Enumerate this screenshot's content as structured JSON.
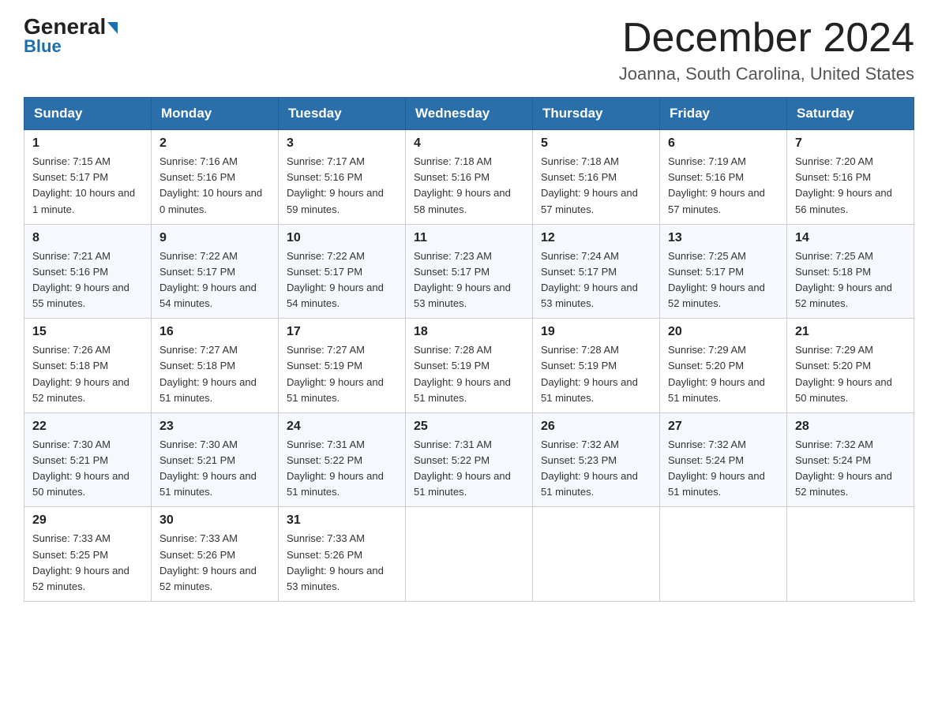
{
  "header": {
    "logo": {
      "line1": "General",
      "line2": "Blue"
    },
    "title": "December 2024",
    "subtitle": "Joanna, South Carolina, United States"
  },
  "weekdays": [
    "Sunday",
    "Monday",
    "Tuesday",
    "Wednesday",
    "Thursday",
    "Friday",
    "Saturday"
  ],
  "weeks": [
    [
      {
        "day": "1",
        "sunrise": "7:15 AM",
        "sunset": "5:17 PM",
        "daylight": "10 hours and 1 minute."
      },
      {
        "day": "2",
        "sunrise": "7:16 AM",
        "sunset": "5:16 PM",
        "daylight": "10 hours and 0 minutes."
      },
      {
        "day": "3",
        "sunrise": "7:17 AM",
        "sunset": "5:16 PM",
        "daylight": "9 hours and 59 minutes."
      },
      {
        "day": "4",
        "sunrise": "7:18 AM",
        "sunset": "5:16 PM",
        "daylight": "9 hours and 58 minutes."
      },
      {
        "day": "5",
        "sunrise": "7:18 AM",
        "sunset": "5:16 PM",
        "daylight": "9 hours and 57 minutes."
      },
      {
        "day": "6",
        "sunrise": "7:19 AM",
        "sunset": "5:16 PM",
        "daylight": "9 hours and 57 minutes."
      },
      {
        "day": "7",
        "sunrise": "7:20 AM",
        "sunset": "5:16 PM",
        "daylight": "9 hours and 56 minutes."
      }
    ],
    [
      {
        "day": "8",
        "sunrise": "7:21 AM",
        "sunset": "5:16 PM",
        "daylight": "9 hours and 55 minutes."
      },
      {
        "day": "9",
        "sunrise": "7:22 AM",
        "sunset": "5:17 PM",
        "daylight": "9 hours and 54 minutes."
      },
      {
        "day": "10",
        "sunrise": "7:22 AM",
        "sunset": "5:17 PM",
        "daylight": "9 hours and 54 minutes."
      },
      {
        "day": "11",
        "sunrise": "7:23 AM",
        "sunset": "5:17 PM",
        "daylight": "9 hours and 53 minutes."
      },
      {
        "day": "12",
        "sunrise": "7:24 AM",
        "sunset": "5:17 PM",
        "daylight": "9 hours and 53 minutes."
      },
      {
        "day": "13",
        "sunrise": "7:25 AM",
        "sunset": "5:17 PM",
        "daylight": "9 hours and 52 minutes."
      },
      {
        "day": "14",
        "sunrise": "7:25 AM",
        "sunset": "5:18 PM",
        "daylight": "9 hours and 52 minutes."
      }
    ],
    [
      {
        "day": "15",
        "sunrise": "7:26 AM",
        "sunset": "5:18 PM",
        "daylight": "9 hours and 52 minutes."
      },
      {
        "day": "16",
        "sunrise": "7:27 AM",
        "sunset": "5:18 PM",
        "daylight": "9 hours and 51 minutes."
      },
      {
        "day": "17",
        "sunrise": "7:27 AM",
        "sunset": "5:19 PM",
        "daylight": "9 hours and 51 minutes."
      },
      {
        "day": "18",
        "sunrise": "7:28 AM",
        "sunset": "5:19 PM",
        "daylight": "9 hours and 51 minutes."
      },
      {
        "day": "19",
        "sunrise": "7:28 AM",
        "sunset": "5:19 PM",
        "daylight": "9 hours and 51 minutes."
      },
      {
        "day": "20",
        "sunrise": "7:29 AM",
        "sunset": "5:20 PM",
        "daylight": "9 hours and 51 minutes."
      },
      {
        "day": "21",
        "sunrise": "7:29 AM",
        "sunset": "5:20 PM",
        "daylight": "9 hours and 50 minutes."
      }
    ],
    [
      {
        "day": "22",
        "sunrise": "7:30 AM",
        "sunset": "5:21 PM",
        "daylight": "9 hours and 50 minutes."
      },
      {
        "day": "23",
        "sunrise": "7:30 AM",
        "sunset": "5:21 PM",
        "daylight": "9 hours and 51 minutes."
      },
      {
        "day": "24",
        "sunrise": "7:31 AM",
        "sunset": "5:22 PM",
        "daylight": "9 hours and 51 minutes."
      },
      {
        "day": "25",
        "sunrise": "7:31 AM",
        "sunset": "5:22 PM",
        "daylight": "9 hours and 51 minutes."
      },
      {
        "day": "26",
        "sunrise": "7:32 AM",
        "sunset": "5:23 PM",
        "daylight": "9 hours and 51 minutes."
      },
      {
        "day": "27",
        "sunrise": "7:32 AM",
        "sunset": "5:24 PM",
        "daylight": "9 hours and 51 minutes."
      },
      {
        "day": "28",
        "sunrise": "7:32 AM",
        "sunset": "5:24 PM",
        "daylight": "9 hours and 52 minutes."
      }
    ],
    [
      {
        "day": "29",
        "sunrise": "7:33 AM",
        "sunset": "5:25 PM",
        "daylight": "9 hours and 52 minutes."
      },
      {
        "day": "30",
        "sunrise": "7:33 AM",
        "sunset": "5:26 PM",
        "daylight": "9 hours and 52 minutes."
      },
      {
        "day": "31",
        "sunrise": "7:33 AM",
        "sunset": "5:26 PM",
        "daylight": "9 hours and 53 minutes."
      },
      null,
      null,
      null,
      null
    ]
  ],
  "labels": {
    "sunrise": "Sunrise: ",
    "sunset": "Sunset: ",
    "daylight": "Daylight: "
  }
}
